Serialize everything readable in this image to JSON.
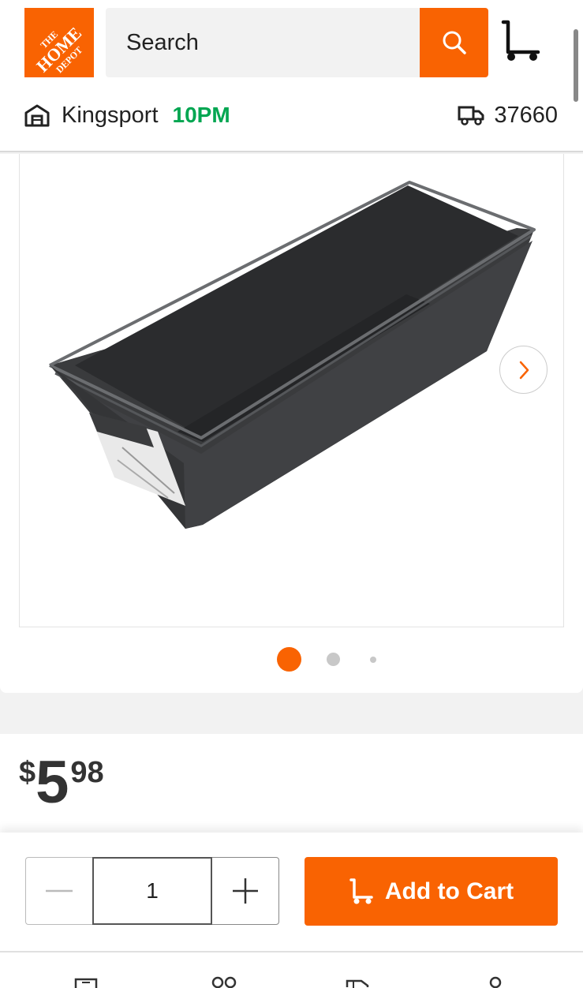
{
  "header": {
    "logo_lines": [
      "THE",
      "HOME",
      "DEPOT"
    ],
    "search_placeholder": "Search",
    "store_name": "Kingsport",
    "store_hours": "10PM",
    "zip_code": "37660"
  },
  "product": {
    "image_count": 3,
    "active_image_index": 0,
    "price_currency": "$",
    "price_dollars": "5",
    "price_cents": "98"
  },
  "actions": {
    "quantity": "1",
    "add_to_cart_label": "Add to Cart"
  },
  "colors": {
    "brand_orange": "#f96302",
    "open_green": "#00a651"
  },
  "icons": [
    "search-icon",
    "cart-icon",
    "store-icon",
    "delivery-truck-icon",
    "chevron-right-icon",
    "minus-icon",
    "plus-icon"
  ]
}
